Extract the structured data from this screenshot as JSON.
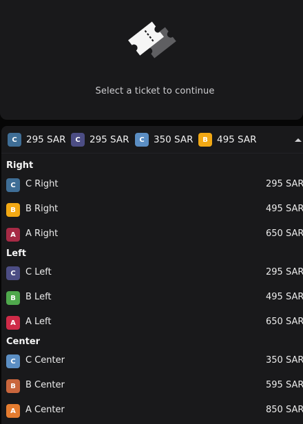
{
  "prompt": {
    "text": "Select a ticket to continue"
  },
  "summary": {
    "chips": [
      {
        "letter": "C",
        "price": "295 SAR",
        "color": "#3f6e96"
      },
      {
        "letter": "C",
        "price": "295 SAR",
        "color": "#4c4d84"
      },
      {
        "letter": "C",
        "price": "350 SAR",
        "color": "#5b8ec3"
      },
      {
        "letter": "B",
        "price": "495 SAR",
        "color": "#f1a814"
      }
    ],
    "toggle_icon": "chevron-up-icon"
  },
  "sections": [
    {
      "title": "Right",
      "rows": [
        {
          "letter": "C",
          "name": "C Right",
          "price": "295 SAR",
          "color": "#3f6e96"
        },
        {
          "letter": "B",
          "name": "B Right",
          "price": "495 SAR",
          "color": "#f1a814"
        },
        {
          "letter": "A",
          "name": "A Right",
          "price": "650 SAR",
          "color": "#a62a45"
        }
      ]
    },
    {
      "title": "Left",
      "rows": [
        {
          "letter": "C",
          "name": "C Left",
          "price": "295 SAR",
          "color": "#4c4d84"
        },
        {
          "letter": "B",
          "name": "B Left",
          "price": "495 SAR",
          "color": "#4fa84c"
        },
        {
          "letter": "A",
          "name": "A Left",
          "price": "650 SAR",
          "color": "#cf2b48"
        }
      ]
    },
    {
      "title": "Center",
      "rows": [
        {
          "letter": "C",
          "name": "C Center",
          "price": "350 SAR",
          "color": "#5b8ec3"
        },
        {
          "letter": "B",
          "name": "B Center",
          "price": "595 SAR",
          "color": "#c9663d"
        },
        {
          "letter": "A",
          "name": "A Center",
          "price": "850 SAR",
          "color": "#e47c30"
        }
      ]
    }
  ],
  "colors": {
    "panel": "#19191b",
    "background": "#060606",
    "text": "#ececec"
  }
}
